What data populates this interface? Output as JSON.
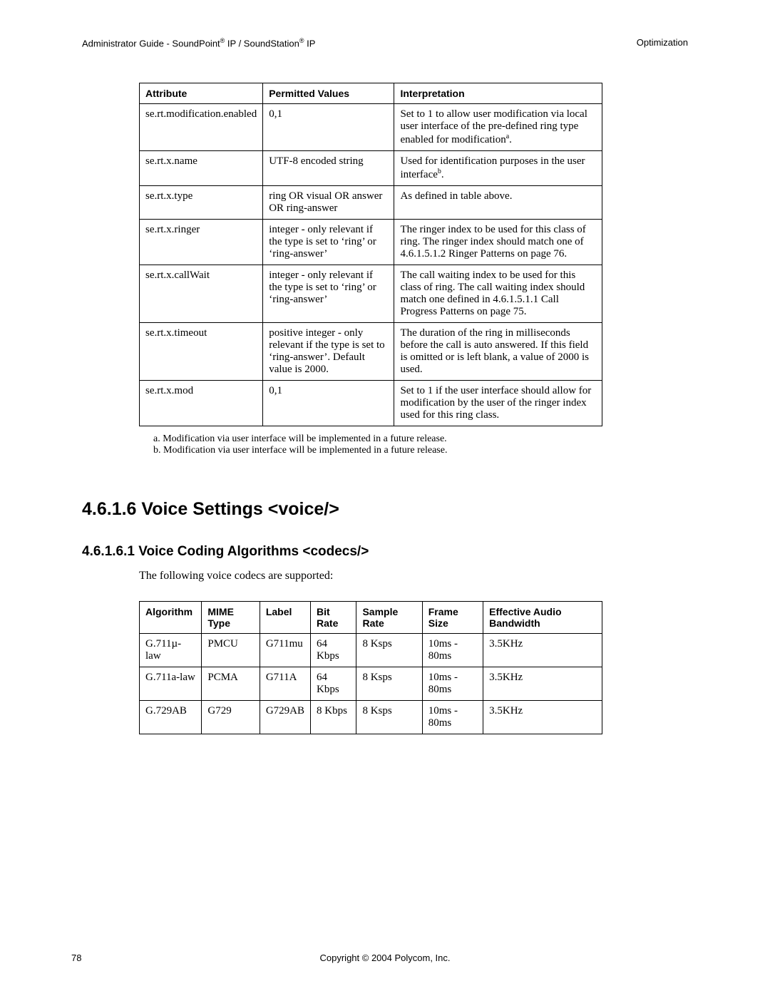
{
  "header": {
    "left_prefix": "Administrator Guide - SoundPoint",
    "left_mid": " IP / SoundStation",
    "left_suffix": " IP",
    "reg": "®",
    "right": "Optimization"
  },
  "attr_table": {
    "head": {
      "c1": "Attribute",
      "c2": "Permitted Values",
      "c3": "Interpretation"
    },
    "rows": [
      {
        "c1": "se.rt.modification.enabled",
        "c2": "0,1",
        "c3a": "Set to 1 to allow user modification via local user interface of the pre-defined ring type enabled for modification",
        "c3sup": "a",
        "c3b": "."
      },
      {
        "c1": "se.rt.x.name",
        "c2": "UTF-8 encoded string",
        "c3a": "Used for identification purposes in the user interface",
        "c3sup": "b",
        "c3b": "."
      },
      {
        "c1": "se.rt.x.type",
        "c2": "ring OR visual OR answer OR ring-answer",
        "c3a": "As defined in table above.",
        "c3sup": "",
        "c3b": ""
      },
      {
        "c1": "se.rt.x.ringer",
        "c2": "integer - only relevant if the type is set to ‘ring’ or ‘ring-answer’",
        "c3a": "The ringer index to be used for this class of ring. The ringer index should match one of 4.6.1.5.1.2 Ringer Patterns on page 76.",
        "c3sup": "",
        "c3b": ""
      },
      {
        "c1": "se.rt.x.callWait",
        "c2": "integer - only relevant if the type is set to ‘ring’ or ‘ring-answer’",
        "c3a": "The call waiting index to be used for this class of ring. The call waiting index should match one defined in 4.6.1.5.1.1 Call Progress Patterns on page 75.",
        "c3sup": "",
        "c3b": ""
      },
      {
        "c1": "se.rt.x.timeout",
        "c2": "positive integer - only relevant if the type is set to ‘ring-answer’. Default value is 2000.",
        "c3a": "The duration of the ring in milliseconds before the call is auto answered. If this field is omitted or is left blank, a value of 2000 is used.",
        "c3sup": "",
        "c3b": ""
      },
      {
        "c1": "se.rt.x.mod",
        "c2": "0,1",
        "c3a": "Set to 1 if the user interface should allow for modification by the user of the ringer index used for this ring class.",
        "c3sup": "",
        "c3b": ""
      }
    ]
  },
  "footnotes": {
    "a": "a.  Modification via user interface will be implemented in a future release.",
    "b": "b.  Modification via user interface will be implemented in a future release."
  },
  "section": {
    "title": "4.6.1.6  Voice Settings <voice/>"
  },
  "subsection": {
    "title": "4.6.1.6.1  Voice Coding Algorithms <codecs/>"
  },
  "intro": "The following voice codecs are supported:",
  "codec_table": {
    "head": {
      "c1": "Algorithm",
      "c2": "MIME Type",
      "c3": "Label",
      "c4": "Bit Rate",
      "c5": "Sample Rate",
      "c6": "Frame Size",
      "c7": "Effective Audio Bandwidth"
    },
    "rows": [
      {
        "c1": "G.711µ-law",
        "c2": "PMCU",
        "c3": "G711mu",
        "c4": "64 Kbps",
        "c5": "8 Ksps",
        "c6": "10ms - 80ms",
        "c7": "3.5KHz"
      },
      {
        "c1": "G.711a-law",
        "c2": "PCMA",
        "c3": "G711A",
        "c4": "64 Kbps",
        "c5": "8 Ksps",
        "c6": "10ms - 80ms",
        "c7": "3.5KHz"
      },
      {
        "c1": "G.729AB",
        "c2": "G729",
        "c3": "G729AB",
        "c4": "8 Kbps",
        "c5": "8 Ksps",
        "c6": "10ms - 80ms",
        "c7": "3.5KHz"
      }
    ]
  },
  "footer": {
    "copyright": "Copyright © 2004 Polycom, Inc.",
    "page": "78"
  }
}
